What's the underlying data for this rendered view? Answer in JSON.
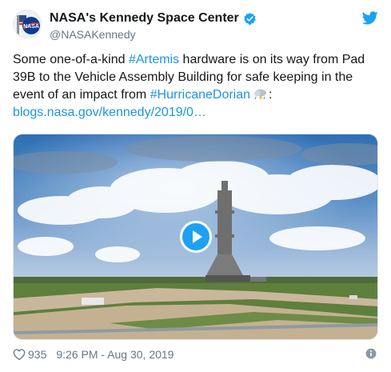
{
  "user": {
    "display_name": "NASA's Kennedy Space Center",
    "handle": "@NASAKennedy",
    "avatar_text": "NASA",
    "verified": true
  },
  "tweet": {
    "text_1": "Some one-of-a-kind ",
    "hashtag_1": "#Artemis",
    "text_2": " hardware is on its way from Pad 39B to the Vehicle Assembly Building for safe keeping in the event of an impact from ",
    "hashtag_2": "#HurricaneDorian",
    "text_3": ":",
    "link": "blogs.nasa.gov/kennedy/2019/0…"
  },
  "media": {
    "type": "video",
    "play_icon": "play-icon"
  },
  "footer": {
    "likes": "935",
    "timestamp": "9:26 PM - Aug 30, 2019"
  },
  "icons": {
    "verified": "verified-badge-icon",
    "brand": "twitter-bird-icon",
    "like": "heart-icon",
    "info": "info-icon",
    "emoji": "cloud-lightning-rain-emoji"
  },
  "colors": {
    "link": "#1b95e0",
    "brand": "#1da1f2",
    "secondary_text": "#657786",
    "primary_text": "#14171a"
  }
}
